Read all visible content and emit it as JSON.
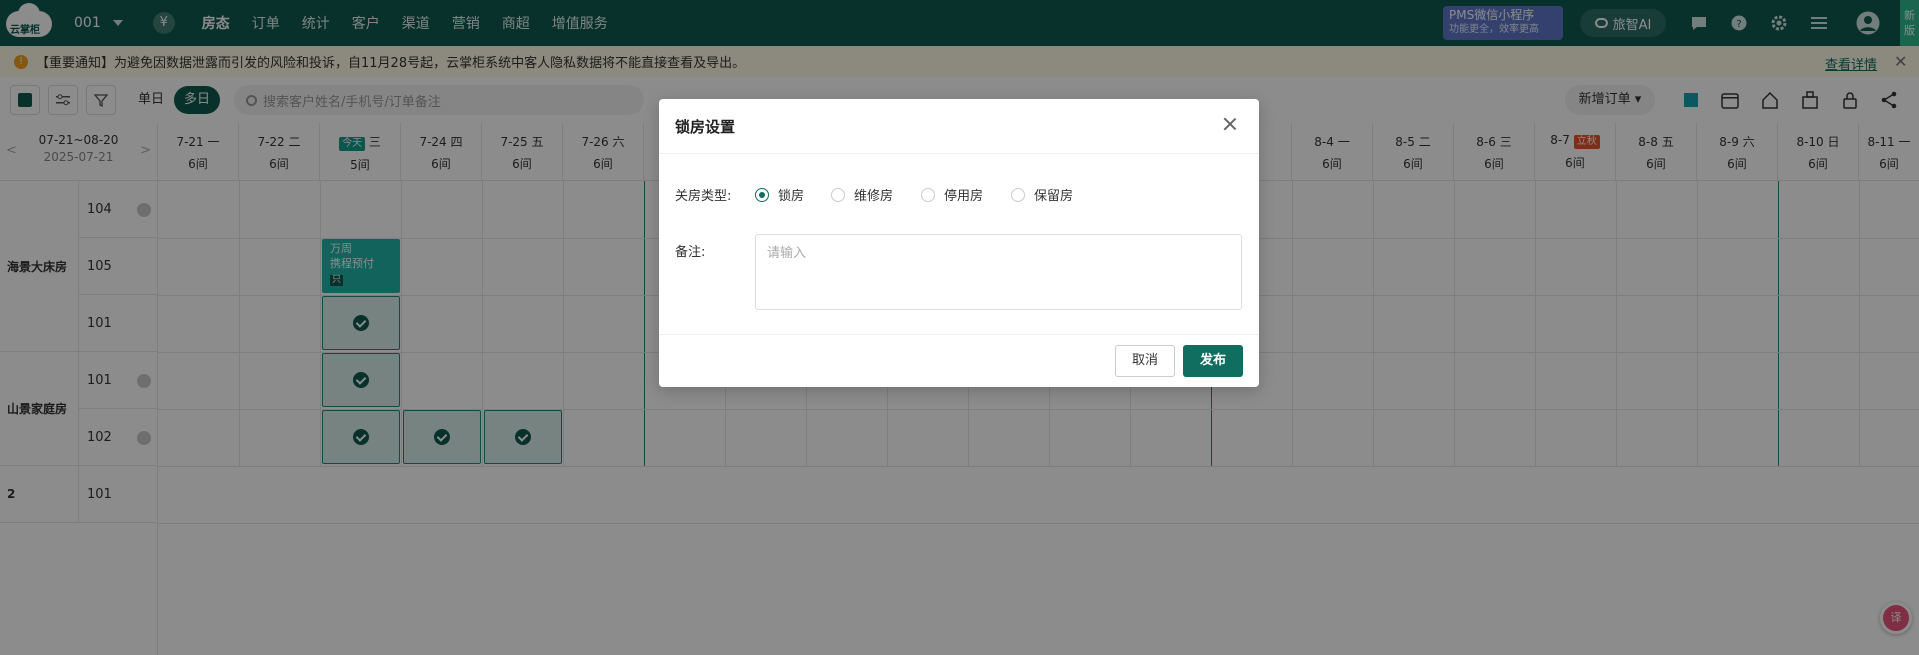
{
  "app": {
    "logo_text": "云掌柜",
    "hotel": "001",
    "currency_icon": "yen-icon",
    "menu": [
      {
        "label": "房态",
        "active": true
      },
      {
        "label": "订单",
        "active": false
      },
      {
        "label": "统计",
        "active": false
      },
      {
        "label": "客户",
        "active": false
      },
      {
        "label": "渠道",
        "active": false
      },
      {
        "label": "营销",
        "active": false
      },
      {
        "label": "商超",
        "active": false
      },
      {
        "label": "增值服务",
        "active": false
      }
    ],
    "miniapp_title": "PMS微信小程序",
    "miniapp_sub": "功能更全，效率更高",
    "ai_label": "旅智AI",
    "new_version": "新版"
  },
  "notice": {
    "text": "【重要通知】为避免因数据泄露而引发的风险和投诉，自11月28号起，云掌柜系统中客人隐私数据将不能直接查看及导出。",
    "detail": "查看详情",
    "close": "✕"
  },
  "toolbar": {
    "single_day": "单日",
    "multi_day": "多日",
    "search_placeholder": "搜索客户姓名/手机号/订单备注",
    "new_order": "新增订单"
  },
  "grid": {
    "range": "07-21~08-20",
    "range_date": "2025-07-21",
    "prev_arrow": "<",
    "next_arrow": ">",
    "days": [
      {
        "date": "7-21",
        "weekday": "一",
        "count": "6间",
        "tag": ""
      },
      {
        "date": "7-22",
        "weekday": "二",
        "count": "6间",
        "tag": ""
      },
      {
        "date": "",
        "weekday": "三",
        "count": "5间",
        "tag": "今天"
      },
      {
        "date": "7-24",
        "weekday": "四",
        "count": "6间",
        "tag": ""
      },
      {
        "date": "7-25",
        "weekday": "五",
        "count": "6间",
        "tag": ""
      },
      {
        "date": "7-26",
        "weekday": "六",
        "count": "6间",
        "tag": ""
      },
      {
        "date": "",
        "weekday": "",
        "count": "",
        "tag": ""
      },
      {
        "date": "",
        "weekday": "",
        "count": "",
        "tag": ""
      },
      {
        "date": "",
        "weekday": "",
        "count": "",
        "tag": ""
      },
      {
        "date": "",
        "weekday": "",
        "count": "",
        "tag": ""
      },
      {
        "date": "",
        "weekday": "",
        "count": "",
        "tag": ""
      },
      {
        "date": "",
        "weekday": "",
        "count": "",
        "tag": ""
      },
      {
        "date": "",
        "weekday": "",
        "count": "",
        "tag": ""
      },
      {
        "date": "",
        "weekday": "",
        "count": "",
        "tag": ""
      },
      {
        "date": "8-4",
        "weekday": "一",
        "count": "6间",
        "tag": ""
      },
      {
        "date": "8-5",
        "weekday": "二",
        "count": "6间",
        "tag": ""
      },
      {
        "date": "8-6",
        "weekday": "三",
        "count": "6间",
        "tag": ""
      },
      {
        "date": "8-7",
        "weekday": "",
        "count": "6间",
        "tag": "立秋"
      },
      {
        "date": "8-8",
        "weekday": "五",
        "count": "6间",
        "tag": ""
      },
      {
        "date": "8-9",
        "weekday": "六",
        "count": "6间",
        "tag": ""
      },
      {
        "date": "8-10",
        "weekday": "日",
        "count": "6间",
        "tag": ""
      },
      {
        "date": "8-11",
        "weekday": "一",
        "count": "6间",
        "tag": ""
      }
    ],
    "room_types": [
      "海景大床房",
      "山景家庭房",
      "2"
    ],
    "rooms": [
      "104",
      "105",
      "101",
      "101",
      "102",
      "101"
    ],
    "order": {
      "name": "万周",
      "source": "携程预付",
      "tag": "只"
    }
  },
  "float_button": "译",
  "dialog": {
    "title": "锁房设置",
    "type_label": "关房类型:",
    "options": [
      "锁房",
      "维修房",
      "停用房",
      "保留房"
    ],
    "selected": "锁房",
    "remark_label": "备注:",
    "remark_placeholder": "请输入",
    "cancel": "取消",
    "publish": "发布"
  },
  "colors": {
    "brand": "#0f5a4f",
    "accent": "#0f6e5f",
    "order": "#1fb5a8"
  }
}
